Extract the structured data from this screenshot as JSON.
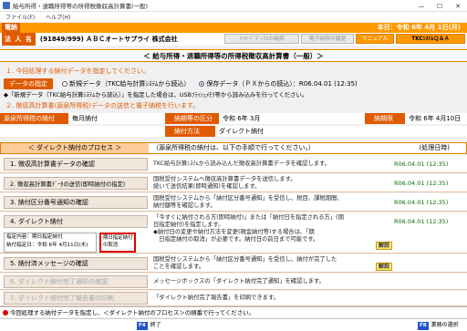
{
  "window": {
    "title": "給与所得・退職所得等の所得税徴収高計算書(一般)",
    "buttons": [
      "—",
      "☐",
      "✕"
    ]
  },
  "menu": [
    "ファイル(F)",
    "ヘルプ(H)"
  ],
  "header": {
    "tag": "電納",
    "date": "本日：令和 6年 4月 1日(月)"
  },
  "company": {
    "label": "法 人 名",
    "name": "(91849/999) ＡＢＣオートサプライ 株式会社"
  },
  "top_buttons": {
    "msgbox": "ﾒｯｾｰｼﾞﾎﾞｯｸｽの確認",
    "history": "電子納税の履歴",
    "manual": "マニュアル",
    "qa": "TKCｼｽﾃﾑＱ＆Ａ"
  },
  "page_title": "＜ 給与所得・退職所得等の所得税徴収高計算書（一般）＞",
  "section1": {
    "title": "１. 今回処理する納付データを指定してください。",
    "button": "データの指定",
    "opt1": "新規データ（TKC給与計算ｼｽﾃﾑから読込）",
    "opt2": "保存データ（ＰＸからの読込）：R06.04.01 (12:35)",
    "note": "◆「新規データ（TKC給与計算ｼｽﾃﾑから読込）」を指定した場合は、USBﾌﾗｯｼｭﾒﾓﾘ等から読み込みを行ってください。"
  },
  "section2": {
    "title": "２. 徴収高計算書(源泉所得税)データの送信と電子納税を行います。"
  },
  "tax": {
    "h1": "源泉所得税の納付",
    "v1": "毎月納付",
    "h2": "納期等の区分",
    "v2": "令和 6年 3月",
    "h3": "納期限",
    "v3": "令和 6年 4月10日",
    "h4": "納付方法",
    "v4": "ダイレクト納付"
  },
  "proc_header": {
    "a": "＜ ダイレクト納付のプロセス ＞",
    "b": "（源泉所得税の納付は、以下の手順で行ってください。）",
    "c": "(処理日時)"
  },
  "steps": [
    {
      "name": "1. 徴収高計算書データの確認",
      "desc": "TKC給与計算ｼｽﾃﾑから読み込んだ徴収高計算書データを確認します。",
      "status": "R06.04.01 (12:35)"
    },
    {
      "name": "2. 徴収高計算書ﾃﾞｰﾀの送信(即時納付の指定)",
      "desc": "国税受付システムへ徴収高計算書データを送信します。\n続いて送信結果(即時通知)を確認します。",
      "status": "R06.04.01 (12:35)"
    },
    {
      "name": "3. 納付区分番号通知の確認",
      "desc": "国税受付システムから「納付区分番号通知」を受信し、税目、課税期間、\n納付額等を確認します。",
      "status": "R06.04.01 (12:35)"
    },
    {
      "name": "4. ダイレクト納付",
      "desc": "「今すぐに納付される方(即時納付)」または「納付日を指定される方」(期\n日指定納付)を指定します。\n◆納付日の変更や納付方法を変更(現金納付等)する場合は、「期\n　日指定納付の取消」が必要です。納付日の前日まで可能です。",
      "status": "R06.04.01 (12:35)"
    },
    {
      "name": "5. 納付済メッセージの確認",
      "desc": "国税受付システムから「納付区分番号通知」を受信し、納付が完了した\nことを確認します。",
      "status": ""
    },
    {
      "name": "6. ダイレクト納付完了通知の確認",
      "desc": "メッセージボックスの「ダイレクト納付完了通知」を確認します。",
      "status": ""
    },
    {
      "name": "7. ダイレクト納付完了報告書の印刷",
      "desc": "「ダイレクト納付完了報告書」を印刷できます。",
      "status": ""
    }
  ],
  "help_label": "解説",
  "info": {
    "l1": "指定内容：期日指定納付",
    "l2": "納付指定日：令和 6年 4月11日(木)"
  },
  "cancel_box": "期日指定納付\nの取消",
  "status": "今回処理する納付データを指定し、＜ダイレクト納付のプロセス＞の順番で行ってください。",
  "fkeys": {
    "f4": "F4",
    "f4l": "終了",
    "f8": "F8",
    "f8l": "業務の選択"
  }
}
